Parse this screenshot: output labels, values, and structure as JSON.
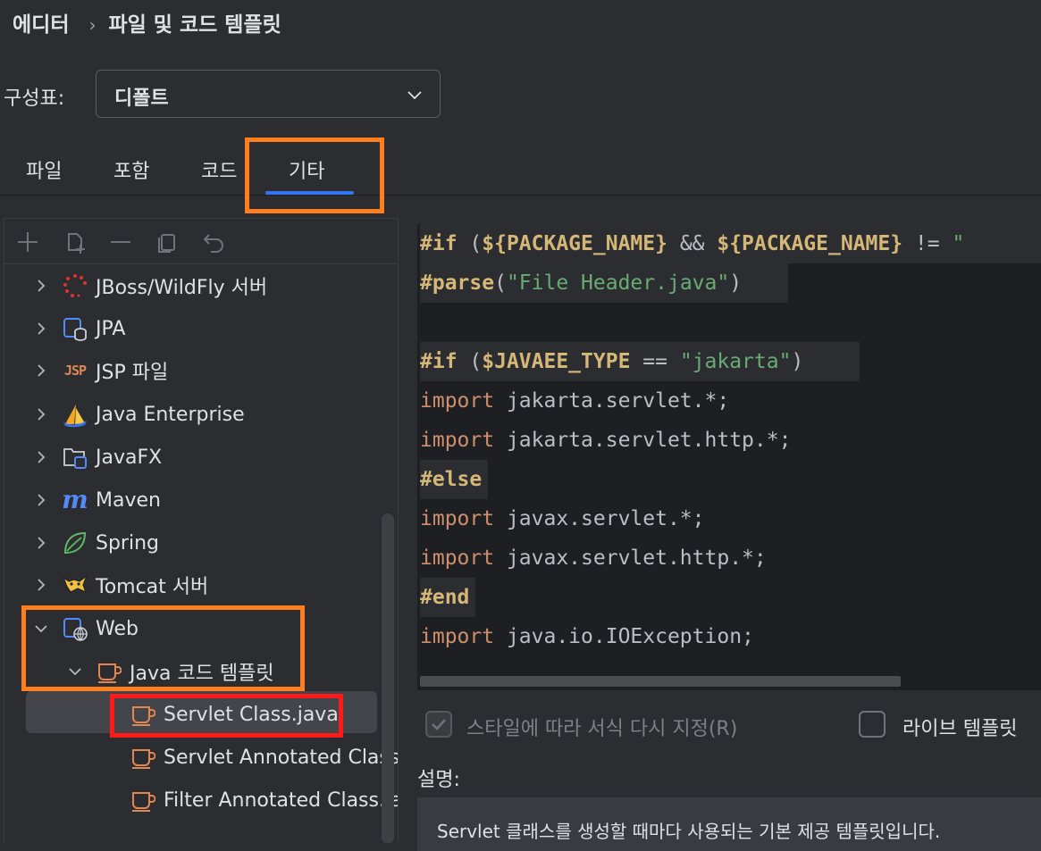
{
  "breadcrumb": {
    "parent": "에디터",
    "separator": "›",
    "current": "파일 및 코드 템플릿"
  },
  "scheme": {
    "label": "구성표:",
    "value": "디폴트"
  },
  "tabs": [
    {
      "label": "파일"
    },
    {
      "label": "포함"
    },
    {
      "label": "코드"
    },
    {
      "label": "기타",
      "selected": true
    }
  ],
  "tree": {
    "items": [
      {
        "label": "JBoss/WildFly 서버",
        "icon": "jboss-icon",
        "expanded": false
      },
      {
        "label": "JPA",
        "icon": "jpa-icon",
        "expanded": false
      },
      {
        "label": "JSP 파일",
        "icon": "jsp-icon",
        "expanded": false
      },
      {
        "label": "Java Enterprise",
        "icon": "java-enterprise-icon",
        "expanded": false
      },
      {
        "label": "JavaFX",
        "icon": "javafx-icon",
        "expanded": false
      },
      {
        "label": "Maven",
        "icon": "maven-icon",
        "expanded": false
      },
      {
        "label": "Spring",
        "icon": "spring-icon",
        "expanded": false
      },
      {
        "label": "Tomcat 서버",
        "icon": "tomcat-icon",
        "expanded": false
      },
      {
        "label": "Web",
        "icon": "web-icon",
        "expanded": true
      },
      {
        "label": "Java 코드 템플릿",
        "icon": "cup-icon",
        "expanded": true
      },
      {
        "label": "Servlet Class.java",
        "icon": "cup-icon",
        "selected": true
      },
      {
        "label": "Servlet Annotated Class.",
        "icon": "cup-icon"
      },
      {
        "label": "Filter Annotated Class.jav",
        "icon": "cup-icon"
      }
    ]
  },
  "editor": {
    "lines": [
      [
        {
          "t": "#if",
          "c": "dir"
        },
        {
          "t": " (",
          "c": "txt"
        },
        {
          "t": "${PACKAGE_NAME}",
          "c": "var"
        },
        {
          "t": " && ",
          "c": "txt"
        },
        {
          "t": "${PACKAGE_NAME}",
          "c": "var"
        },
        {
          "t": " != ",
          "c": "txt"
        },
        {
          "t": "\"",
          "c": "str"
        }
      ],
      [
        {
          "t": "#parse",
          "c": "dir"
        },
        {
          "t": "(",
          "c": "txt"
        },
        {
          "t": "\"File Header.java\"",
          "c": "str"
        },
        {
          "t": ")",
          "c": "txt"
        }
      ],
      [],
      [
        {
          "t": "#if",
          "c": "dir"
        },
        {
          "t": " (",
          "c": "txt"
        },
        {
          "t": "$JAVAEE_TYPE",
          "c": "var"
        },
        {
          "t": " == ",
          "c": "txt"
        },
        {
          "t": "\"jakarta\"",
          "c": "str"
        },
        {
          "t": ")",
          "c": "txt"
        }
      ],
      [
        {
          "t": "import",
          "c": "imp"
        },
        {
          "t": " jakarta.servlet.*;",
          "c": "txt"
        }
      ],
      [
        {
          "t": "import",
          "c": "imp"
        },
        {
          "t": " jakarta.servlet.http.*;",
          "c": "txt"
        }
      ],
      [
        {
          "t": "#else",
          "c": "dir"
        }
      ],
      [
        {
          "t": "import",
          "c": "imp"
        },
        {
          "t": " javax.servlet.*;",
          "c": "txt"
        }
      ],
      [
        {
          "t": "import",
          "c": "imp"
        },
        {
          "t": " javax.servlet.http.*;",
          "c": "txt"
        }
      ],
      [
        {
          "t": "#end",
          "c": "dir"
        }
      ],
      [
        {
          "t": "import",
          "c": "imp"
        },
        {
          "t": " java.io.IOException;",
          "c": "txt"
        }
      ]
    ]
  },
  "options": {
    "reformat_label": "스타일에 따라 서식 다시 지정(R)",
    "reformat_checked": true,
    "reformat_enabled": false,
    "live_template_label": "라이브 템플릿",
    "live_template_checked": false
  },
  "description": {
    "label": "설명:",
    "text": "Servlet 클래스를 생성할 때마다 사용되는 기본 제공 템플릿입니다."
  },
  "colors": {
    "accent": "#3574f0",
    "annotation_orange": "#ff7f1e",
    "annotation_red": "#ff1a1a"
  }
}
